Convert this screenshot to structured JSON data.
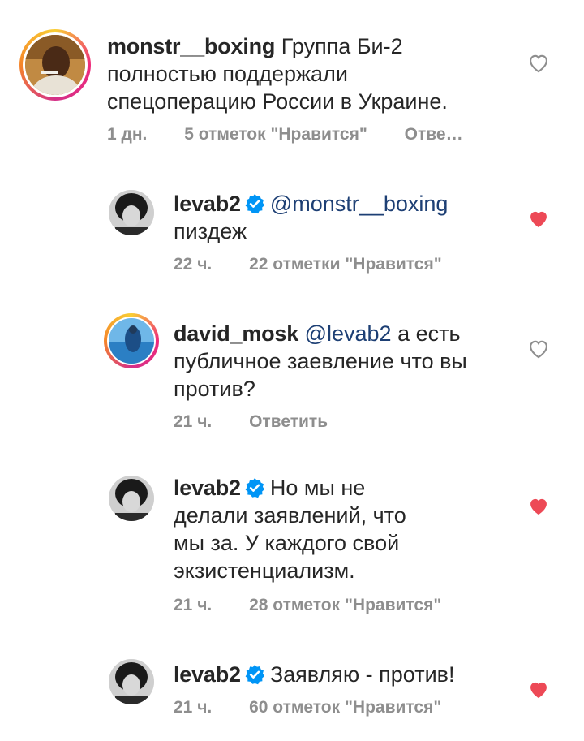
{
  "comments": [
    {
      "username": "monstr__boxing",
      "text": "Группа Би-2 полностью поддержали спецоперацию России в Украине.",
      "time": "1 дн.",
      "likes": "5 отметок \"Нравится\"",
      "reply": "Отве…",
      "liked": false,
      "verified": false
    },
    {
      "username": "levab2",
      "mention": "@monstr__boxing",
      "text": "пиздеж",
      "time": "22 ч.",
      "likes": "22 отметки \"Нравится\"",
      "liked": true,
      "verified": true
    },
    {
      "username": "david_mosk",
      "mention": "@levab2",
      "text": "а есть публичное заевление что вы против?",
      "time": "21 ч.",
      "reply": "Ответить",
      "liked": false,
      "verified": false
    },
    {
      "username": "levab2",
      "text": "Но мы не делали заявлений, что мы за. У каждого свой экзистенциализм.",
      "time": "21 ч.",
      "likes": "28 отметок \"Нравится\"",
      "liked": true,
      "verified": true
    },
    {
      "username": "levab2",
      "text": "Заявляю - против!",
      "time": "21 ч.",
      "likes": "60 отметок \"Нравится\"",
      "liked": true,
      "verified": true
    }
  ],
  "colors": {
    "like_red": "#ed4956",
    "verified_blue": "#0095f6",
    "muted": "#8e8e8e",
    "mention": "#1d3f74"
  },
  "icons": {
    "verified": "verified-badge-icon",
    "heart": "heart-icon"
  }
}
